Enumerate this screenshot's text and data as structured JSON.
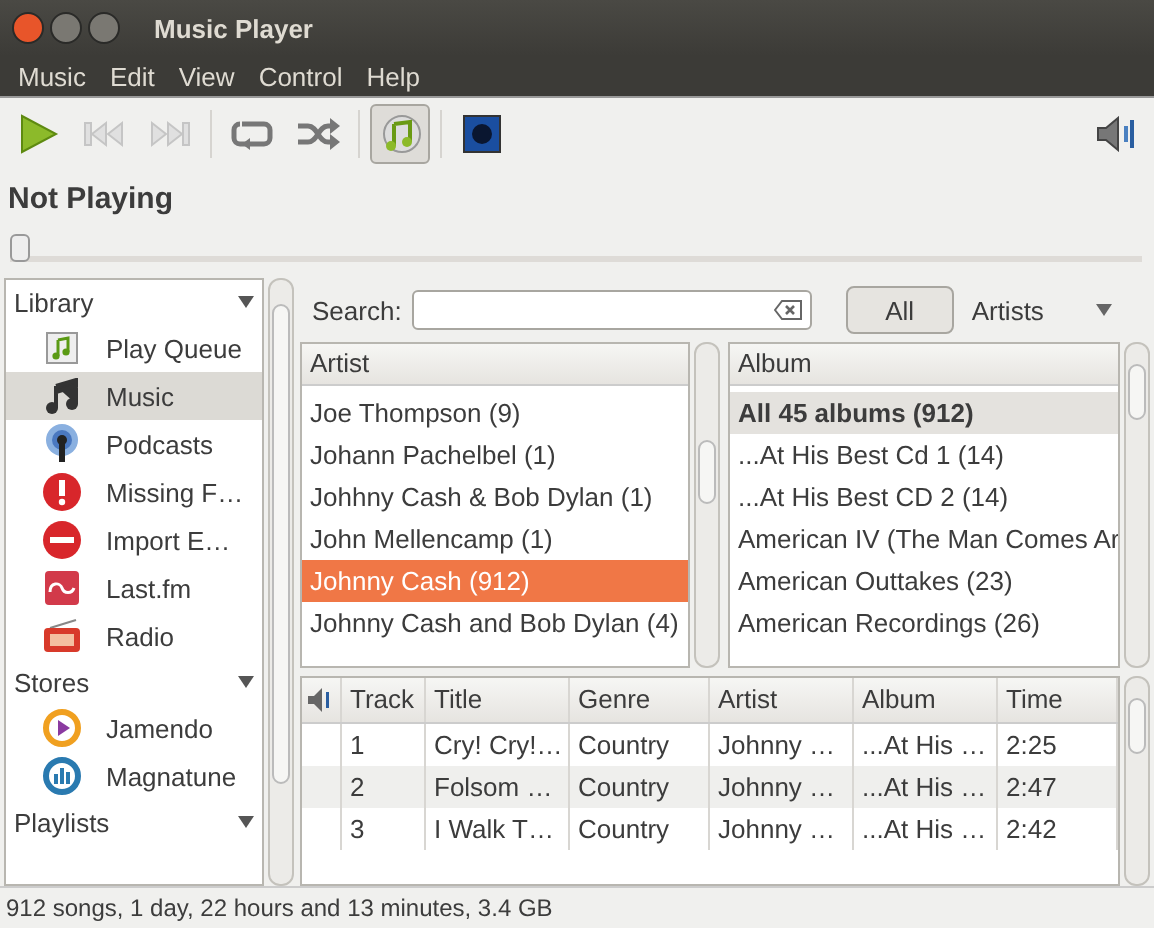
{
  "window": {
    "title": "Music Player"
  },
  "menu": [
    "Music",
    "Edit",
    "View",
    "Control",
    "Help"
  ],
  "toolbar": [
    {
      "kind": "play",
      "disabled": false,
      "selected": false
    },
    {
      "kind": "previous",
      "disabled": true,
      "selected": false
    },
    {
      "kind": "next",
      "disabled": true,
      "selected": false
    },
    {
      "kind": "repeat",
      "disabled": false,
      "selected": false
    },
    {
      "kind": "shuffle",
      "disabled": false,
      "selected": false
    },
    {
      "kind": "browse",
      "disabled": false,
      "selected": true
    },
    {
      "kind": "visualization",
      "disabled": false,
      "selected": false
    }
  ],
  "now_playing": {
    "title": "Not Playing",
    "level": 0
  },
  "sidebar": {
    "sections": [
      {
        "title": "Library",
        "expanded": true,
        "items": [
          {
            "label": "Play Queue",
            "kind": "queue",
            "selected": false
          },
          {
            "label": "Music",
            "kind": "music",
            "selected": true
          },
          {
            "label": "Podcasts",
            "kind": "podcast",
            "selected": false
          },
          {
            "label": "Missing F…",
            "kind": "missing",
            "selected": false
          },
          {
            "label": "Import E…",
            "kind": "error",
            "selected": false
          },
          {
            "label": "Last.fm",
            "kind": "lastfm",
            "selected": false
          },
          {
            "label": "Radio",
            "kind": "radio",
            "selected": false
          }
        ]
      },
      {
        "title": "Stores",
        "expanded": true,
        "items": [
          {
            "label": "Jamendo",
            "kind": "jamendo",
            "selected": false
          },
          {
            "label": "Magnatune",
            "kind": "magnatune",
            "selected": false
          }
        ]
      },
      {
        "title": "Playlists",
        "expanded": true
      }
    ]
  },
  "search": {
    "label": "Search:"
  },
  "filter": {
    "button": "All",
    "dropdown": "Artists"
  },
  "artist_list": {
    "header": "Artist",
    "items": [
      {
        "label": "Joe Thompson (9)",
        "selected": false
      },
      {
        "label": "Johann Pachelbel (1)",
        "selected": false
      },
      {
        "label": "Johhny Cash & Bob Dylan (1)",
        "selected": false
      },
      {
        "label": "John Mellencamp (1)",
        "selected": false
      },
      {
        "label": "Johnny Cash (912)",
        "selected": true
      },
      {
        "label": "Johnny Cash and Bob Dylan (4)",
        "selected": false
      }
    ]
  },
  "album_list": {
    "header": "Album",
    "items": [
      {
        "label": "All 45 albums (912)",
        "kind": "all",
        "selected": true
      },
      {
        "label": "...At His Best Cd 1 (14)",
        "kind": "album",
        "selected": false
      },
      {
        "label": "...At His Best CD 2 (14)",
        "kind": "album",
        "selected": false
      },
      {
        "label": "American IV (The Man Comes Ar",
        "kind": "album",
        "selected": false
      },
      {
        "label": "American Outtakes (23)",
        "kind": "album",
        "selected": false
      },
      {
        "label": "American Recordings (26)",
        "kind": "album",
        "selected": false
      }
    ]
  },
  "tracks": {
    "columns": [
      "Track",
      "Title",
      "Genre",
      "Artist",
      "Album",
      "Time"
    ],
    "rows": [
      [
        "1",
        "Cry! Cry!…",
        "Country",
        "Johnny …",
        "...At His …",
        "2:25"
      ],
      [
        "2",
        "Folsom …",
        "Country",
        "Johnny …",
        "...At His …",
        "2:47"
      ],
      [
        "3",
        "I Walk T…",
        "Country",
        "Johnny …",
        "...At His …",
        "2:42"
      ]
    ]
  },
  "status_bar": "912 songs, 1 day, 22 hours and 13 minutes, 3.4 GB"
}
